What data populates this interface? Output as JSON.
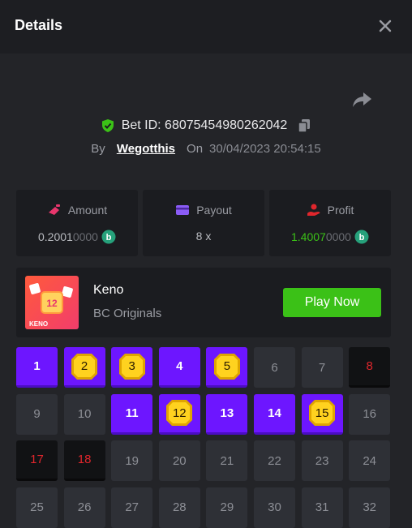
{
  "header": {
    "title": "Details"
  },
  "bet": {
    "id_label": "Bet ID: 68075454980262042",
    "by_label": "By",
    "user": "Wegotthis",
    "on_label": "On",
    "datetime": "30/04/2023 20:54:15"
  },
  "stats": {
    "amount": {
      "label": "Amount",
      "value_main": "0.2001",
      "value_dim": "0000"
    },
    "payout": {
      "label": "Payout",
      "value": "8 x"
    },
    "profit": {
      "label": "Profit",
      "value_main": "1.4007",
      "value_dim": "0000"
    }
  },
  "game": {
    "name": "Keno",
    "provider": "BC Originals",
    "play_label": "Play Now",
    "thumb_number": "12",
    "thumb_text": "KENO"
  },
  "board": {
    "numbers": [
      1,
      2,
      3,
      4,
      5,
      6,
      7,
      8,
      9,
      10,
      11,
      12,
      13,
      14,
      15,
      16,
      17,
      18,
      19,
      20,
      21,
      22,
      23,
      24,
      25,
      26,
      27,
      28,
      29,
      30,
      31,
      32
    ],
    "picked": [
      1,
      4,
      11,
      13,
      14
    ],
    "hits": [
      2,
      3,
      5,
      12,
      15
    ],
    "misses": [
      8,
      17,
      18
    ]
  },
  "colors": {
    "accent": "#6d16ff",
    "green": "#3bc117",
    "red": "#e0262c",
    "gold": "#f7c820"
  }
}
